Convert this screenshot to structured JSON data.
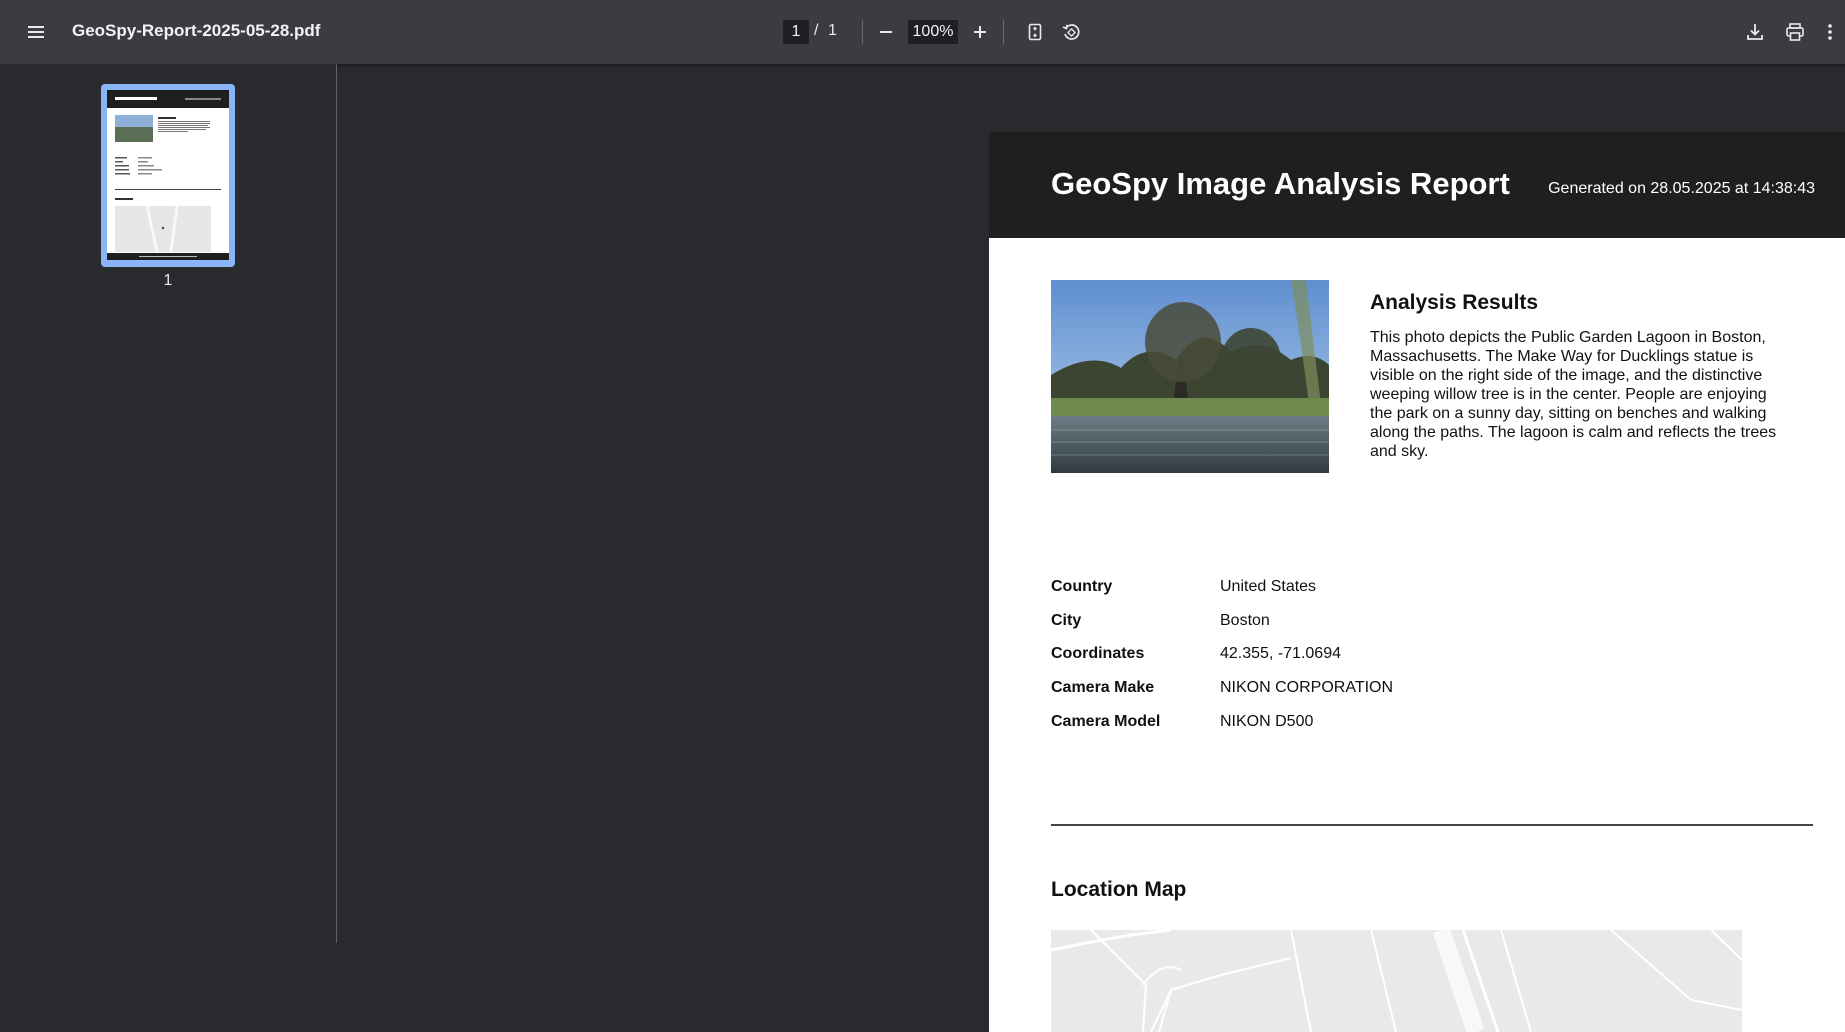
{
  "toolbar": {
    "file_name": "GeoSpy-Report-2025-05-28.pdf",
    "current_page": "1",
    "page_separator": "/",
    "total_pages": "1",
    "zoom": "100%"
  },
  "sidebar": {
    "thumbnail_page_number": "1"
  },
  "report": {
    "title": "GeoSpy Image Analysis Report",
    "generated": "Generated on 28.05.2025 at 14:38:43",
    "analysis_heading": "Analysis Results",
    "analysis_text": "This photo depicts the Public Garden Lagoon in Boston, Massachusetts. The Make Way for Ducklings statue is visible on the right side of the image, and the distinctive weeping willow tree is in the center. People are enjoying the park on a sunny day, sitting on benches and walking along the paths. The lagoon is calm and reflects the trees and sky.",
    "details": [
      {
        "key": "Country",
        "value": "United States"
      },
      {
        "key": "City",
        "value": "Boston"
      },
      {
        "key": "Coordinates",
        "value": "42.355, -71.0694"
      },
      {
        "key": "Camera Make",
        "value": "NIKON CORPORATION"
      },
      {
        "key": "Camera Model",
        "value": "NIKON D500"
      }
    ],
    "map_heading": "Location Map"
  },
  "colors": {
    "toolbar_bg": "#3b3c3f",
    "viewer_bg": "#282a2d",
    "report_header_bg": "#1f1f1f",
    "thumbnail_highlight": "#8ab4f8"
  },
  "icons": [
    "menu-icon",
    "zoom-out-icon",
    "zoom-in-icon",
    "fit-page-icon",
    "rotate-icon",
    "download-icon",
    "print-icon",
    "more-vert-icon"
  ]
}
